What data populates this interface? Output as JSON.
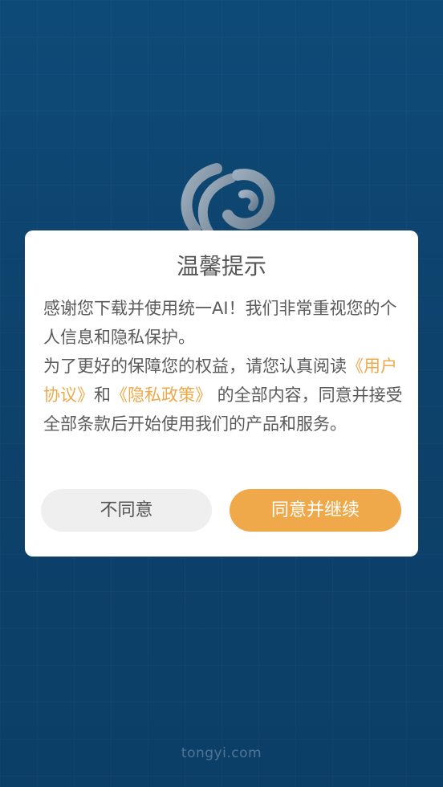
{
  "dialog": {
    "title": "温馨提示",
    "line1": "感谢您下载并使用统一AI！我们非常重视您的个人信息和隐私保护。",
    "line2_prefix": "为了更好的保障您的权益，请您认真阅读",
    "user_agreement_link": "《用户协议》",
    "conjunction": "和",
    "privacy_policy_link": "《隐私政策》",
    "line2_suffix": " 的全部内容，同意并接受全部条款后开始使用我们的产品和服务。",
    "disagree_label": "不同意",
    "agree_label": "同意并继续"
  },
  "splash": {
    "footer_domain": "tongyi.com"
  },
  "colors": {
    "background": "#0d426c",
    "accent": "#efa94a",
    "dialog_background": "#ffffff",
    "secondary_button": "#efefef",
    "text": "#5a5a5a"
  },
  "icons": {
    "logo": "tongyi-globe-logo-icon"
  }
}
